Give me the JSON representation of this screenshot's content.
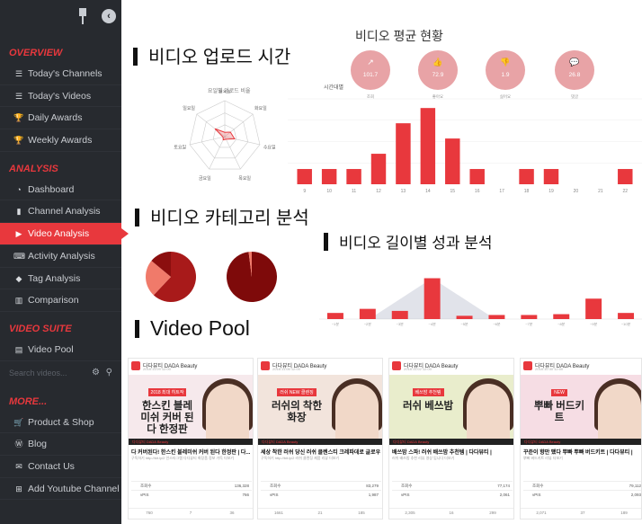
{
  "sidebar": {
    "sections": {
      "overview": "OVERVIEW",
      "analysis": "ANALYSIS",
      "video_suite": "VIDEO SUITE",
      "more": "MORE..."
    },
    "overview_items": [
      {
        "label": "Today's Channels",
        "icon": "list-icon"
      },
      {
        "label": "Today's Videos",
        "icon": "list-icon"
      },
      {
        "label": "Daily Awards",
        "icon": "trophy-icon"
      },
      {
        "label": "Weekly Awards",
        "icon": "trophy-icon"
      }
    ],
    "analysis_items": [
      {
        "label": "Dashboard",
        "icon": "dashboard-icon"
      },
      {
        "label": "Channel Analysis",
        "icon": "channel-icon"
      },
      {
        "label": "Video Analysis",
        "icon": "youtube-icon",
        "active": true
      },
      {
        "label": "Activity Analysis",
        "icon": "keyboard-icon"
      },
      {
        "label": "Tag Analysis",
        "icon": "tag-icon"
      },
      {
        "label": "Comparison",
        "icon": "columns-icon"
      }
    ],
    "video_suite_items": [
      {
        "label": "Video Pool",
        "icon": "file-icon"
      }
    ],
    "search_placeholder": "Search videos...",
    "more_items": [
      {
        "label": "Product & Shop",
        "icon": "cart-icon"
      },
      {
        "label": "Blog",
        "icon": "wordpress-icon"
      },
      {
        "label": "Contact Us",
        "icon": "envelope-icon"
      },
      {
        "label": "Add Youtube Channel",
        "icon": "plus-square-icon"
      }
    ]
  },
  "sections": {
    "upload_time": "비디오 업로드 시간",
    "avg_status": "비디오 평균 현황",
    "category": "비디오 카테고리 분석",
    "length_perf": "비디오 길이별 성과 분석",
    "video_pool": "Video Pool"
  },
  "radar": {
    "title": "요일별 업로드 비율",
    "axes": [
      "월요일",
      "화요일",
      "수요일",
      "목요일",
      "금요일",
      "토요일",
      "일요일"
    ],
    "values": [
      0.12,
      0.2,
      0.28,
      0.08,
      0.1,
      0.05,
      0.35
    ]
  },
  "avg_status": {
    "colors": {
      "accent": "#e8383d",
      "circle": "#e8a3a6"
    },
    "metrics": [
      {
        "icon": "line-chart-icon",
        "value": "101.7",
        "label": "조회"
      },
      {
        "icon": "thumbs-up-icon",
        "value": "72.9",
        "label": "좋아요"
      },
      {
        "icon": "thumbs-down-icon",
        "value": "1.9",
        "label": "싫어요"
      },
      {
        "icon": "comment-icon",
        "value": "26.8",
        "label": "댓글"
      }
    ]
  },
  "chart_data": [
    {
      "type": "bar",
      "title": "",
      "ylabel": "시간대별",
      "categories": [
        "9",
        "10",
        "11",
        "12",
        "13",
        "14",
        "15",
        "16",
        "17",
        "18",
        "19",
        "20",
        "21",
        "22"
      ],
      "values": [
        1,
        1,
        1,
        2,
        4,
        5,
        3,
        1,
        0,
        1,
        1,
        0,
        0,
        1
      ],
      "ylim": [
        0,
        5.6
      ]
    },
    {
      "type": "pie",
      "title": "",
      "slices": [
        {
          "label": "",
          "value": 62,
          "color": "#a81a1a"
        },
        {
          "label": "",
          "value": 24,
          "color": "#f07a6a"
        },
        {
          "label": "",
          "value": 14,
          "color": "#8b0e0e"
        }
      ]
    },
    {
      "type": "pie",
      "title": "",
      "slices": [
        {
          "label": "",
          "value": 98,
          "color": "#7e0a0a"
        },
        {
          "label": "",
          "value": 2,
          "color": "#f07a6a"
        }
      ]
    },
    {
      "type": "bar",
      "title": "",
      "categories": [
        "~1분",
        "~2분",
        "~3분",
        "~4분",
        "~5분",
        "~6분",
        "~7분",
        "~8분",
        "~9분",
        "~10분"
      ],
      "values": [
        0.15,
        0.25,
        0.2,
        1.0,
        0.08,
        0.1,
        0.1,
        0.12,
        0.5,
        0.15
      ],
      "ylim": [
        0,
        1.1
      ]
    }
  ],
  "video_pool": {
    "cards": [
      {
        "channel": "다다뷰티 DADA Beauty",
        "date": "2018.11.09 12:00",
        "tag": "2018 최대 히트작",
        "headline": "한스킨 블레미쉬 커버 된다 한정판",
        "title": "다 커버된다! 한스킨 블레미쉬 커버 된다 한정판 | 다...",
        "desc": "구독하기 http://bit.ly/2 인스타그램 다다뷰티 화장품 정보 가득 더보기",
        "views": "136,328",
        "vpi": "766",
        "likes": "760",
        "dislikes": "7",
        "comments": "36"
      },
      {
        "channel": "다다뷰티 DADA Beauty",
        "date": "2018.11.06 12:00",
        "tag": "러쉬 NEW 클렌징",
        "headline": "러쉬의 착한 화장",
        "title": "세상 착한 러쉬 당신 러쉬 클렌스티 크레파데로 글로우 ...",
        "desc": "구독하기 http://bit.ly/2 러쉬 클렌징 제품 리뷰 더보기",
        "views": "83,279",
        "vpi": "1,987",
        "likes": "1661",
        "dislikes": "21",
        "comments": "185"
      },
      {
        "channel": "다다뷰티 DADA Beauty",
        "date": "2018.11.02 12:00",
        "tag": "베쓰밤 추천템",
        "headline": "러쉬 베쓰밤",
        "title": "배쓰밤 스파! 러쉬 배쓰밤 추천템 | 다다뷰티 |",
        "desc": "러쉬 배쓰밤 추천 리뷰 영상 입니다 더보기",
        "views": "77,174",
        "vpi": "2,061",
        "likes": "2,305",
        "dislikes": "16",
        "comments": "299"
      },
      {
        "channel": "다다뷰티 DADA Beauty",
        "date": "2018.10.30 12:00",
        "tag": "NEW",
        "headline": "뿌빠 버드키트",
        "title": "꾸준이 향만 뗐다 뿌빠 뿌빠 버드키트 | 다다뷰티 |",
        "desc": "뿌빠 버드키트 리뷰 더보기",
        "views": "79,112",
        "vpi": "2,093",
        "likes": "2,071",
        "dislikes": "37",
        "comments": "189"
      }
    ],
    "labels": {
      "views": "조회수",
      "vpi": "vPIS",
      "likes": "좋아요",
      "dislikes": "싫어요",
      "comments": "댓글"
    }
  }
}
